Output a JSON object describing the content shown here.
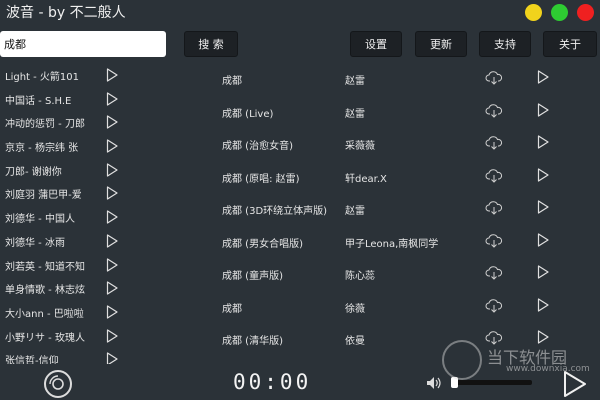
{
  "window": {
    "title": "波音 - by 不二般人",
    "buttons": [
      {
        "name": "minimize",
        "color": "#f1d31c"
      },
      {
        "name": "maximize",
        "color": "#2ecc32"
      },
      {
        "name": "close",
        "color": "#ef2020"
      }
    ]
  },
  "search": {
    "value": "成都",
    "button_label": "搜 索"
  },
  "toolbar": {
    "settings": "设置",
    "update": "更新",
    "support": "支持",
    "about": "关于"
  },
  "left_list": [
    "Light - 火箭101",
    "中国话 - S.H.E",
    "冲动的惩罚 - 刀郎",
    "京京 - 杨宗纬 张",
    "刀郎- 谢谢你",
    "刘庭羽 蒲巴甲-爱",
    "刘德华 - 中国人",
    "刘德华 - 冰雨",
    "刘若英 - 知道不知",
    "单身情歌 - 林志炫",
    "大小ann - 巴啦啦",
    "小野リサ - 玫瑰人",
    "张信哲-信仰"
  ],
  "results": [
    {
      "title": "成都",
      "artist": "赵雷"
    },
    {
      "title": "成都 (Live)",
      "artist": "赵雷"
    },
    {
      "title": "成都 (治愈女音)",
      "artist": "采薇薇"
    },
    {
      "title": "成都 (原唱: 赵雷)",
      "artist": "轩dear.X"
    },
    {
      "title": "成都 (3D环绕立体声版)",
      "artist": "赵雷"
    },
    {
      "title": "成都 (男女合唱版)",
      "artist": "甲子Leona,南枫同学"
    },
    {
      "title": "成都 (童声版)",
      "artist": "陈心蕊"
    },
    {
      "title": "成都",
      "artist": "徐薇"
    },
    {
      "title": "成都 (清华版)",
      "artist": "依曼"
    }
  ],
  "player": {
    "time": "00:00",
    "progress": 0
  },
  "watermark": {
    "brand": "当下软件园",
    "url": "www.downxia.com"
  },
  "icons": {
    "play": "play-icon",
    "download": "cloud-download-icon",
    "disc": "disc-icon",
    "volume": "speaker-icon"
  }
}
